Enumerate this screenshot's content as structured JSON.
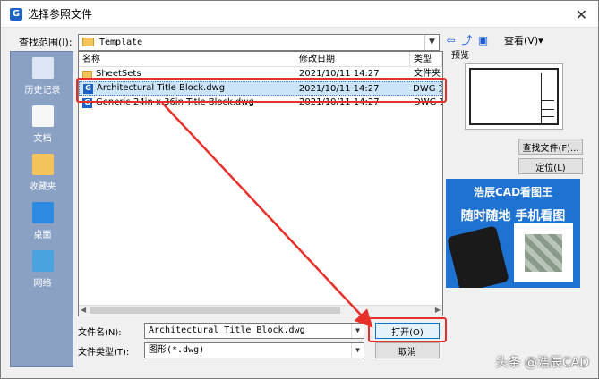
{
  "titlebar": {
    "title": "选择参照文件"
  },
  "lookin": {
    "label": "查找范围(I):",
    "value": "Template",
    "view_label": "查看(V)▾"
  },
  "places": [
    {
      "label": "历史记录"
    },
    {
      "label": "文档"
    },
    {
      "label": "收藏夹"
    },
    {
      "label": "桌面"
    },
    {
      "label": "网络"
    }
  ],
  "filelist": {
    "headers": {
      "name": "名称",
      "date": "修改日期",
      "type": "类型"
    },
    "rows": [
      {
        "name": "SheetSets",
        "date": "2021/10/11 14:27",
        "type": "文件夹"
      },
      {
        "name": "Architectural Title Block.dwg",
        "date": "2021/10/11 14:27",
        "type": "DWG 文"
      },
      {
        "name": "Generic 24in x 36in Title Block.dwg",
        "date": "2021/10/11 14:27",
        "type": "DWG 文"
      }
    ]
  },
  "preview": {
    "label": "预览"
  },
  "buttons": {
    "find": "查找文件(F)...",
    "locate": "定位(L)",
    "open": "打开(O)",
    "cancel": "取消"
  },
  "filename": {
    "label": "文件名(N):",
    "value": "Architectural Title Block.dwg"
  },
  "filetype": {
    "label": "文件类型(T):",
    "value": "图形(*.dwg)"
  },
  "ad": {
    "title": "浩辰CAD看图王",
    "subtitle": "随时随地 手机看图"
  },
  "watermark": "头条 @浩辰CAD",
  "colors": {
    "accent": "#1e64c8",
    "highlight": "#e8302a",
    "selection": "#cce4f7"
  }
}
